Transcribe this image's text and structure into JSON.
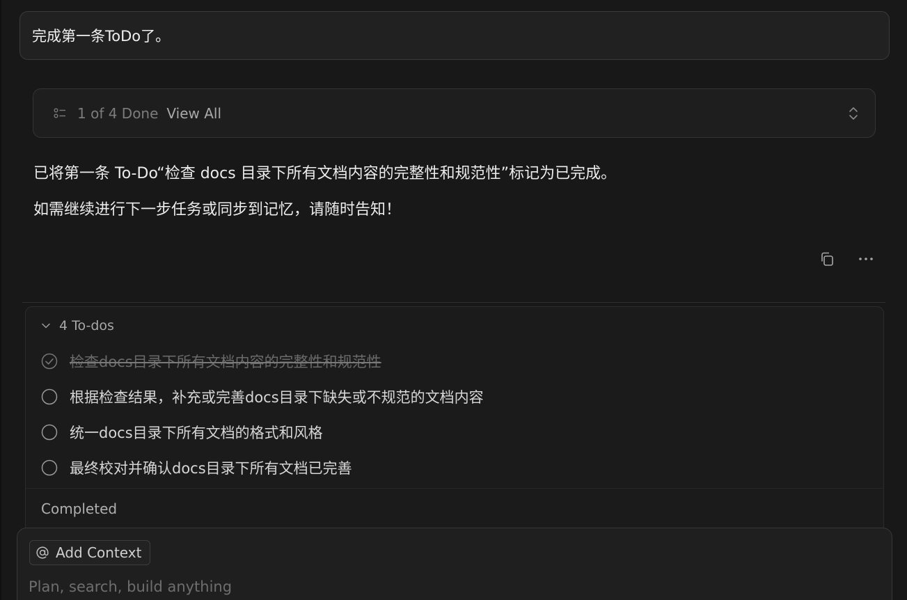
{
  "user_message": "完成第一条ToDo了。",
  "progress": {
    "count_label": "1 of 4 Done",
    "view_all_label": "View All",
    "done": 1,
    "total": 4
  },
  "assistant": {
    "lines": [
      "已将第一条 To-Do“检查 docs 目录下所有文档内容的完整性和规范性”标记为已完成。",
      "如需继续进行下一步任务或同步到记忆，请随时告知！"
    ]
  },
  "actions": {
    "copy_icon": "copy-icon",
    "more_icon": "more-horizontal-icon"
  },
  "todos": {
    "header_label": "4 To-dos",
    "items": [
      {
        "text": "检查docs目录下所有文档内容的完整性和规范性",
        "done": true
      },
      {
        "text": "根据检查结果，补充或完善docs目录下缺失或不规范的文档内容",
        "done": false
      },
      {
        "text": "统一docs目录下所有文档的格式和风格",
        "done": false
      },
      {
        "text": "最终校对并确认docs目录下所有文档已完善",
        "done": false
      }
    ],
    "completed_label": "Completed"
  },
  "composer": {
    "add_context_label": "Add Context",
    "placeholder": "Plan, search, build anything"
  },
  "colors": {
    "background": "#181818",
    "panel": "#1f1f1f",
    "border": "#383838",
    "text": "#ececec",
    "muted": "#7c7c7c"
  }
}
